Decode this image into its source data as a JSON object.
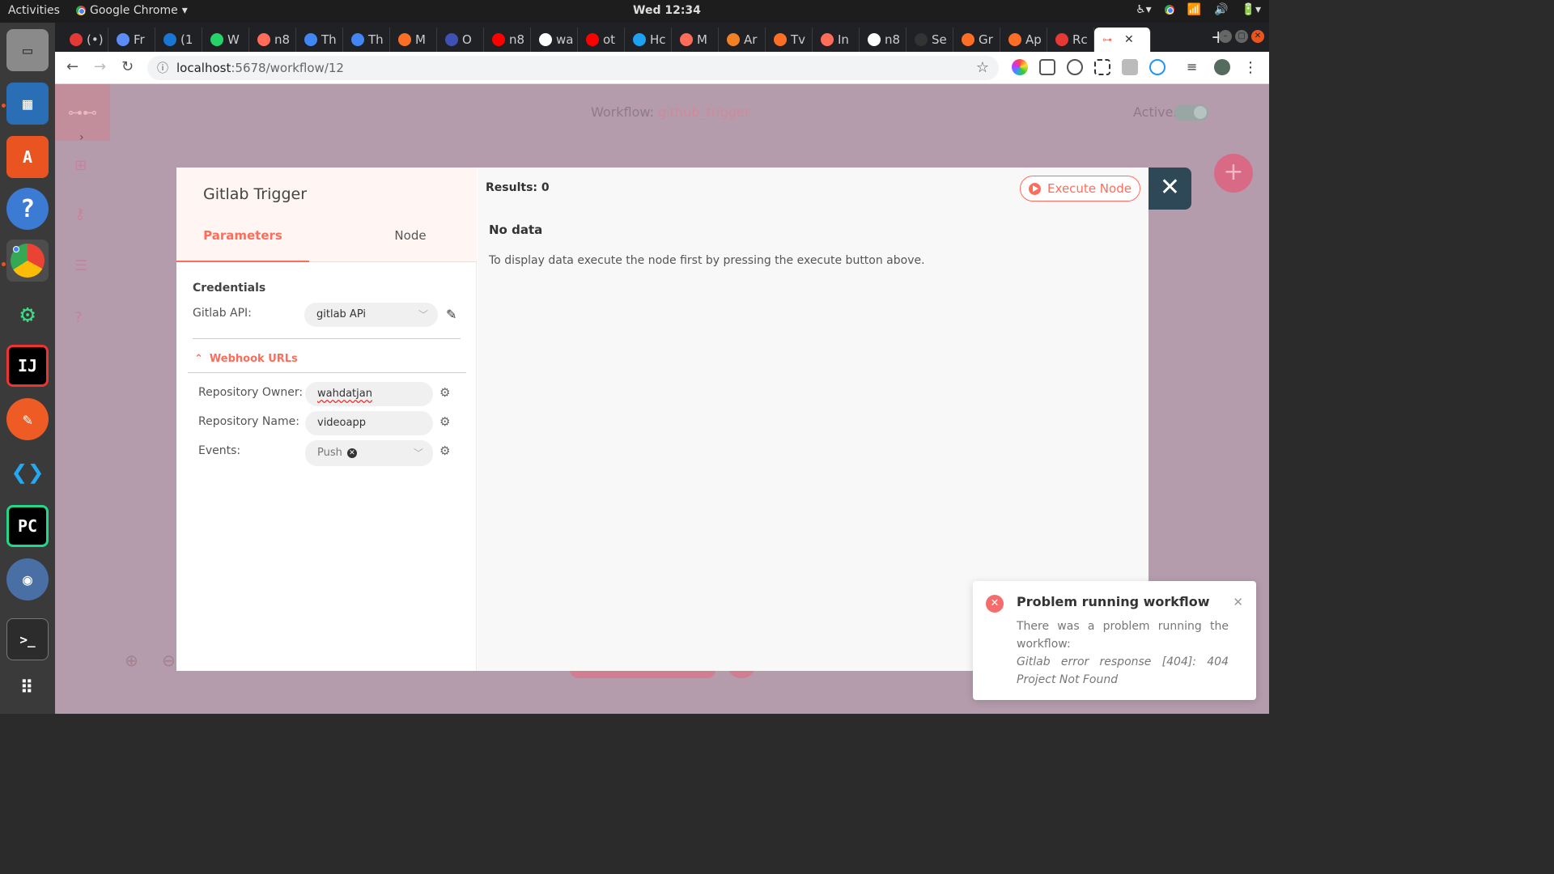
{
  "os": {
    "activities": "Activities",
    "app_name": "Google Chrome",
    "clock": "Wed 12:34"
  },
  "dock": {
    "items": [
      "files",
      "image-viewer",
      "software-center",
      "help",
      "chrome",
      "android-studio",
      "intellij",
      "postman",
      "vscode",
      "pycharm",
      "obs",
      "terminal",
      "app-grid"
    ]
  },
  "browser": {
    "tabs": [
      {
        "label": "(•)",
        "color": "#e53935"
      },
      {
        "label": "Fr",
        "color": "#5c8df6"
      },
      {
        "label": "(1",
        "color": "#1976d2"
      },
      {
        "label": "W",
        "color": "#25d366"
      },
      {
        "label": "n8",
        "color": "#ff6d5a"
      },
      {
        "label": "Th",
        "color": "#4285f4"
      },
      {
        "label": "Th",
        "color": "#4285f4"
      },
      {
        "label": "M",
        "color": "#fc6d26"
      },
      {
        "label": "O",
        "color": "#3f51b5"
      },
      {
        "label": "n8",
        "color": "#ff0000"
      },
      {
        "label": "wa",
        "color": "#ffffff"
      },
      {
        "label": "ot",
        "color": "#ff0000"
      },
      {
        "label": "Hc",
        "color": "#1da1f2"
      },
      {
        "label": "M",
        "color": "#ff6d5a"
      },
      {
        "label": "Ar",
        "color": "#f48024"
      },
      {
        "label": "Tv",
        "color": "#fc6d26"
      },
      {
        "label": "In",
        "color": "#ff6d5a"
      },
      {
        "label": "n8",
        "color": "#ffffff"
      },
      {
        "label": "Se",
        "color": "#333333"
      },
      {
        "label": "Gr",
        "color": "#fc6d26"
      },
      {
        "label": "Ap",
        "color": "#fc6d26"
      },
      {
        "label": "Rc",
        "color": "#e53935"
      }
    ],
    "active_tab_close": "✕",
    "new_tab": "+",
    "url_host": "localhost",
    "url_path": ":5678/workflow/12"
  },
  "workflow": {
    "label": "Workflow:",
    "name": "github_trigger",
    "active_label": "Active:"
  },
  "node_dialog": {
    "title": "Gitlab Trigger",
    "tab_parameters": "Parameters",
    "tab_node": "Node",
    "credentials_title": "Credentials",
    "gitlab_api_label": "Gitlab API:",
    "gitlab_api_value": "gitlab APi",
    "webhook_urls": "Webhook URLs",
    "repo_owner_label": "Repository Owner:",
    "repo_owner_value": "wahdatjan",
    "repo_name_label": "Repository Name:",
    "repo_name_value": "videoapp",
    "events_label": "Events:",
    "events_value": "Push",
    "results": "Results: 0",
    "execute_node": "Execute Node",
    "no_data": "No data",
    "hint": "To display data execute the node first by pressing the execute button above."
  },
  "notification": {
    "title": "Problem running workflow",
    "message": "There was a problem running the workflow:",
    "error": "Gitlab error response [404]: 404 Project Not Found"
  },
  "colors": {
    "accent": "#ff6d5a",
    "close_button": "#2f4858",
    "error": "#f56c6c",
    "canvas_overlay": "#b49cad"
  }
}
